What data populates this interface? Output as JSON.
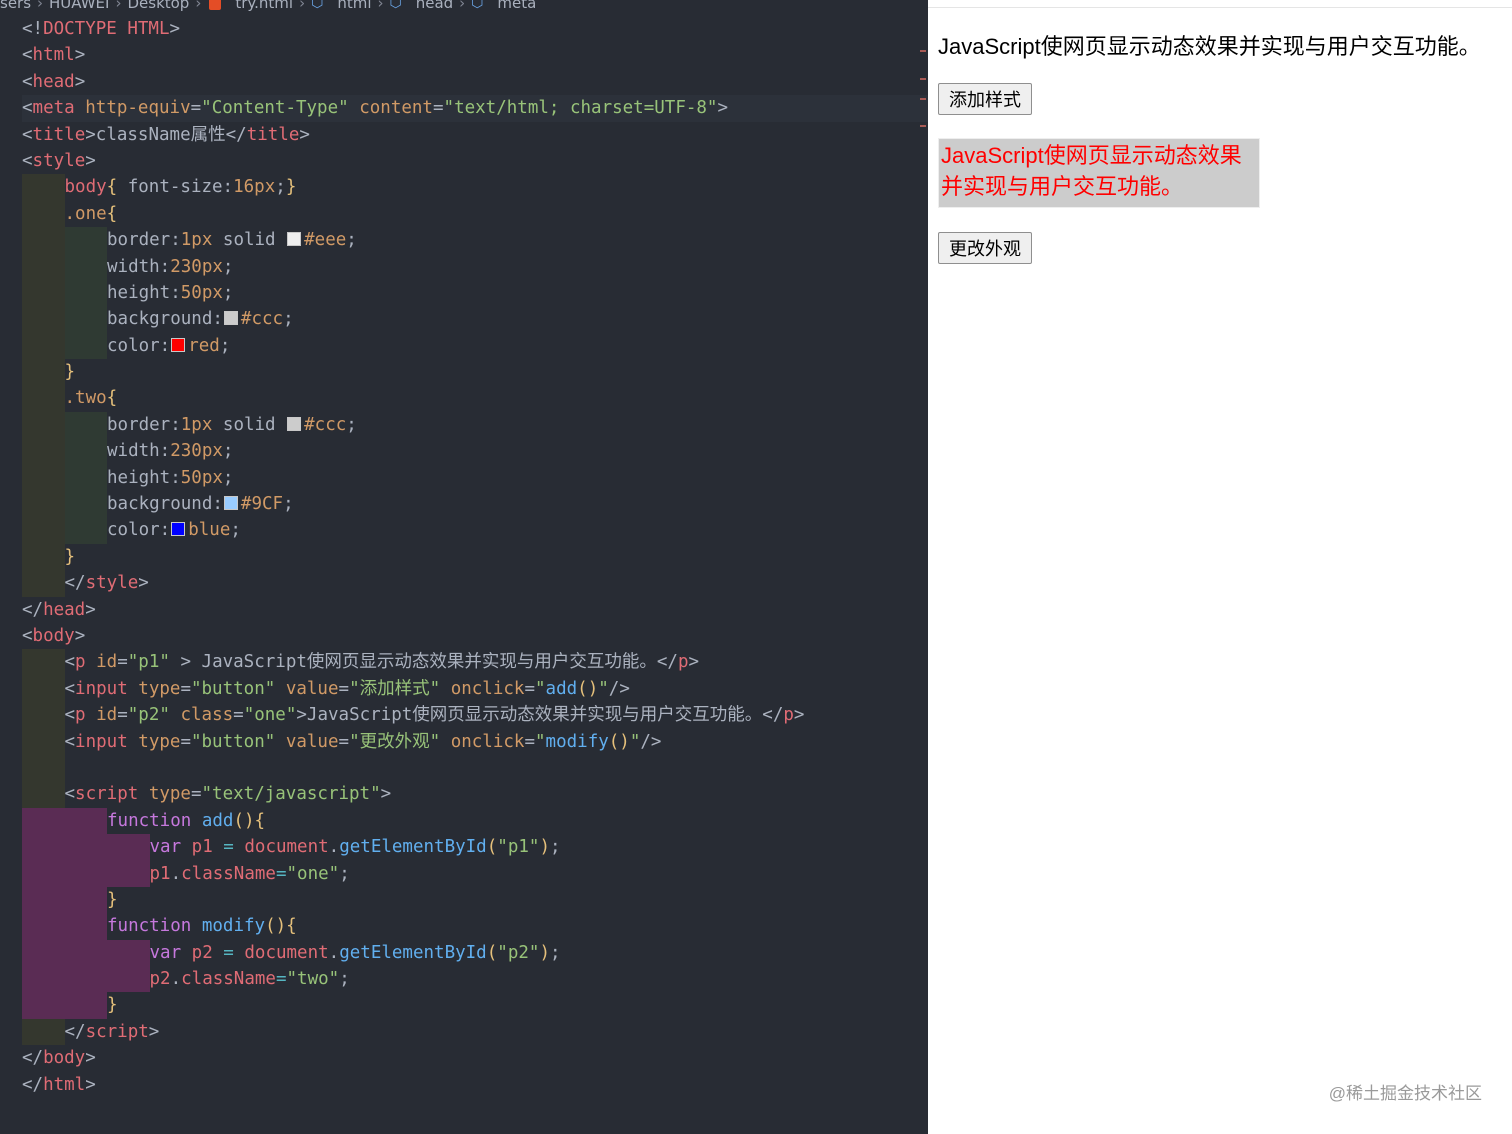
{
  "breadcrumb": {
    "items": [
      "sers",
      "HUAWEI",
      "Desktop",
      "try.html",
      "html",
      "head",
      "meta"
    ]
  },
  "editor": {
    "lines": [
      {
        "g": [],
        "tokens": [
          [
            "t-br",
            "<!"
          ],
          [
            "t-tag",
            "DOCTYPE HTML"
          ],
          [
            "t-br",
            ">"
          ]
        ]
      },
      {
        "g": [],
        "tokens": [
          [
            "t-br",
            "<"
          ],
          [
            "t-tag",
            "html"
          ],
          [
            "t-br",
            ">"
          ]
        ]
      },
      {
        "g": [],
        "tokens": [
          [
            "t-br",
            "<"
          ],
          [
            "t-tag",
            "head"
          ],
          [
            "t-br",
            ">"
          ]
        ]
      },
      {
        "g": [],
        "hl": true,
        "tokens": [
          [
            "t-br",
            "<"
          ],
          [
            "t-tag",
            "meta"
          ],
          [
            "t-plain",
            " "
          ],
          [
            "t-attr",
            "http-equiv"
          ],
          [
            "t-plain",
            "="
          ],
          [
            "t-str",
            "\"Content-Type\""
          ],
          [
            "t-plain",
            " "
          ],
          [
            "t-attr",
            "content"
          ],
          [
            "t-plain",
            "="
          ],
          [
            "t-str",
            "\"text/html; charset=UTF-8\""
          ],
          [
            "t-br",
            ">"
          ]
        ]
      },
      {
        "g": [],
        "tokens": [
          [
            "t-br",
            "<"
          ],
          [
            "t-tag",
            "title"
          ],
          [
            "t-br",
            ">"
          ],
          [
            "t-plain",
            "className属性"
          ],
          [
            "t-br",
            "</"
          ],
          [
            "t-tag",
            "title"
          ],
          [
            "t-br",
            ">"
          ]
        ]
      },
      {
        "g": [],
        "tokens": [
          [
            "t-br",
            "<"
          ],
          [
            "t-tag",
            "style"
          ],
          [
            "t-br",
            ">"
          ]
        ]
      },
      {
        "g": [
          "g1"
        ],
        "tokens": [
          [
            "t-sel",
            "body"
          ],
          [
            "t-yellow",
            "{"
          ],
          [
            "t-plain",
            " font-size:"
          ],
          [
            "t-num",
            "16px"
          ],
          [
            "t-plain",
            ";"
          ],
          [
            "t-yellow",
            "}"
          ]
        ]
      },
      {
        "g": [
          "g1"
        ],
        "tokens": [
          [
            "t-cls",
            ".one"
          ],
          [
            "t-yellow",
            "{"
          ]
        ]
      },
      {
        "g": [
          "g1",
          "g2"
        ],
        "tokens": [
          [
            "t-prop",
            "border:"
          ],
          [
            "t-num",
            "1px"
          ],
          [
            "t-plain",
            " solid "
          ],
          [
            "swatch",
            "#eeeeee"
          ],
          [
            "t-num",
            "#eee"
          ],
          [
            "t-plain",
            ";"
          ]
        ]
      },
      {
        "g": [
          "g1",
          "g2"
        ],
        "tokens": [
          [
            "t-prop",
            "width:"
          ],
          [
            "t-num",
            "230px"
          ],
          [
            "t-plain",
            ";"
          ]
        ]
      },
      {
        "g": [
          "g1",
          "g2"
        ],
        "tokens": [
          [
            "t-prop",
            "height:"
          ],
          [
            "t-num",
            "50px"
          ],
          [
            "t-plain",
            ";"
          ]
        ]
      },
      {
        "g": [
          "g1",
          "g2"
        ],
        "tokens": [
          [
            "t-prop",
            "background:"
          ],
          [
            "swatch",
            "#cccccc"
          ],
          [
            "t-num",
            "#ccc"
          ],
          [
            "t-plain",
            ";"
          ]
        ]
      },
      {
        "g": [
          "g1",
          "g2"
        ],
        "tokens": [
          [
            "t-prop",
            "color:"
          ],
          [
            "swatch",
            "#ff0000"
          ],
          [
            "t-num",
            "red"
          ],
          [
            "t-plain",
            ";"
          ]
        ]
      },
      {
        "g": [
          "g1"
        ],
        "tokens": [
          [
            "t-yellow",
            "}"
          ]
        ]
      },
      {
        "g": [
          "g1"
        ],
        "tokens": [
          [
            "t-cls",
            ".two"
          ],
          [
            "t-yellow",
            "{"
          ]
        ]
      },
      {
        "g": [
          "g1",
          "g2"
        ],
        "tokens": [
          [
            "t-prop",
            "border:"
          ],
          [
            "t-num",
            "1px"
          ],
          [
            "t-plain",
            " solid "
          ],
          [
            "swatch",
            "#cccccc"
          ],
          [
            "t-num",
            "#ccc"
          ],
          [
            "t-plain",
            ";"
          ]
        ]
      },
      {
        "g": [
          "g1",
          "g2"
        ],
        "tokens": [
          [
            "t-prop",
            "width:"
          ],
          [
            "t-num",
            "230px"
          ],
          [
            "t-plain",
            ";"
          ]
        ]
      },
      {
        "g": [
          "g1",
          "g2"
        ],
        "tokens": [
          [
            "t-prop",
            "height:"
          ],
          [
            "t-num",
            "50px"
          ],
          [
            "t-plain",
            ";"
          ]
        ]
      },
      {
        "g": [
          "g1",
          "g2"
        ],
        "tokens": [
          [
            "t-prop",
            "background:"
          ],
          [
            "swatch",
            "#99ccff"
          ],
          [
            "t-num",
            "#9CF"
          ],
          [
            "t-plain",
            ";"
          ]
        ]
      },
      {
        "g": [
          "g1",
          "g2"
        ],
        "tokens": [
          [
            "t-prop",
            "color:"
          ],
          [
            "swatch",
            "#0000ff"
          ],
          [
            "t-num",
            "blue"
          ],
          [
            "t-plain",
            ";"
          ]
        ]
      },
      {
        "g": [
          "g1"
        ],
        "tokens": [
          [
            "t-yellow",
            "}"
          ]
        ]
      },
      {
        "g": [
          "g1"
        ],
        "tokens": [
          [
            "t-br",
            "</"
          ],
          [
            "t-tag",
            "style"
          ],
          [
            "t-br",
            ">"
          ]
        ]
      },
      {
        "g": [],
        "tokens": [
          [
            "t-br",
            "</"
          ],
          [
            "t-tag",
            "head"
          ],
          [
            "t-br",
            ">"
          ]
        ]
      },
      {
        "g": [],
        "tokens": [
          [
            "t-br",
            "<"
          ],
          [
            "t-tag",
            "body"
          ],
          [
            "t-br",
            ">"
          ]
        ]
      },
      {
        "g": [
          "g1"
        ],
        "tokens": [
          [
            "t-br",
            "<"
          ],
          [
            "t-tag",
            "p"
          ],
          [
            "t-plain",
            " "
          ],
          [
            "t-attr",
            "id"
          ],
          [
            "t-plain",
            "="
          ],
          [
            "t-str",
            "\"p1\""
          ],
          [
            "t-plain",
            " > JavaScript使网页显示动态效果并实现与用户交互功能。"
          ],
          [
            "t-br",
            "</"
          ],
          [
            "t-tag",
            "p"
          ],
          [
            "t-br",
            ">"
          ]
        ]
      },
      {
        "g": [
          "g1"
        ],
        "tokens": [
          [
            "t-br",
            "<"
          ],
          [
            "t-tag",
            "input"
          ],
          [
            "t-plain",
            " "
          ],
          [
            "t-attr",
            "type"
          ],
          [
            "t-plain",
            "="
          ],
          [
            "t-str",
            "\"button\""
          ],
          [
            "t-plain",
            " "
          ],
          [
            "t-attr",
            "value"
          ],
          [
            "t-plain",
            "="
          ],
          [
            "t-str",
            "\"添加样式\""
          ],
          [
            "t-plain",
            " "
          ],
          [
            "t-attr",
            "onclick"
          ],
          [
            "t-plain",
            "="
          ],
          [
            "t-str",
            "\""
          ],
          [
            "t-fn",
            "add"
          ],
          [
            "t-yellow",
            "()"
          ],
          [
            "t-str",
            "\""
          ],
          [
            "t-br",
            "/>"
          ]
        ]
      },
      {
        "g": [
          "g1"
        ],
        "tokens": [
          [
            "t-br",
            "<"
          ],
          [
            "t-tag",
            "p"
          ],
          [
            "t-plain",
            " "
          ],
          [
            "t-attr",
            "id"
          ],
          [
            "t-plain",
            "="
          ],
          [
            "t-str",
            "\"p2\""
          ],
          [
            "t-plain",
            " "
          ],
          [
            "t-attr",
            "class"
          ],
          [
            "t-plain",
            "="
          ],
          [
            "t-str",
            "\"one\""
          ],
          [
            "t-plain",
            ">JavaScript使网页显示动态效果并实现与用户交互功能。"
          ],
          [
            "t-br",
            "</"
          ],
          [
            "t-tag",
            "p"
          ],
          [
            "t-br",
            ">"
          ]
        ]
      },
      {
        "g": [
          "g1"
        ],
        "tokens": [
          [
            "t-br",
            "<"
          ],
          [
            "t-tag",
            "input"
          ],
          [
            "t-plain",
            " "
          ],
          [
            "t-attr",
            "type"
          ],
          [
            "t-plain",
            "="
          ],
          [
            "t-str",
            "\"button\""
          ],
          [
            "t-plain",
            " "
          ],
          [
            "t-attr",
            "value"
          ],
          [
            "t-plain",
            "="
          ],
          [
            "t-str",
            "\"更改外观\""
          ],
          [
            "t-plain",
            " "
          ],
          [
            "t-attr",
            "onclick"
          ],
          [
            "t-plain",
            "="
          ],
          [
            "t-str",
            "\""
          ],
          [
            "t-fn",
            "modify"
          ],
          [
            "t-yellow",
            "()"
          ],
          [
            "t-str",
            "\""
          ],
          [
            "t-br",
            "/>"
          ]
        ]
      },
      {
        "g": [
          "g1"
        ],
        "tokens": []
      },
      {
        "g": [
          "g1"
        ],
        "tokens": [
          [
            "t-br",
            "<"
          ],
          [
            "t-tag",
            "script"
          ],
          [
            "t-plain",
            " "
          ],
          [
            "t-attr",
            "type"
          ],
          [
            "t-plain",
            "="
          ],
          [
            "t-str",
            "\"text/javascript\""
          ],
          [
            "t-br",
            ">"
          ]
        ]
      },
      {
        "g": [
          "gp",
          "gp"
        ],
        "tokens": [
          [
            "t-kw",
            "function"
          ],
          [
            "t-plain",
            " "
          ],
          [
            "t-fn",
            "add"
          ],
          [
            "t-yellow",
            "(){"
          ]
        ]
      },
      {
        "g": [
          "gp",
          "gp",
          "gp"
        ],
        "tokens": [
          [
            "t-kw",
            "var"
          ],
          [
            "t-plain",
            " "
          ],
          [
            "t-var",
            "p1"
          ],
          [
            "t-plain",
            " "
          ],
          [
            "t-op",
            "="
          ],
          [
            "t-plain",
            " "
          ],
          [
            "t-var",
            "document"
          ],
          [
            "t-plain",
            "."
          ],
          [
            "t-fn",
            "getElementById"
          ],
          [
            "t-yellow",
            "("
          ],
          [
            "t-str",
            "\"p1\""
          ],
          [
            "t-yellow",
            ")"
          ],
          [
            "t-plain",
            ";"
          ]
        ]
      },
      {
        "g": [
          "gp",
          "gp",
          "gp"
        ],
        "tokens": [
          [
            "t-var",
            "p1"
          ],
          [
            "t-plain",
            "."
          ],
          [
            "t-var",
            "className"
          ],
          [
            "t-op",
            "="
          ],
          [
            "t-str",
            "\"one\""
          ],
          [
            "t-plain",
            ";"
          ]
        ]
      },
      {
        "g": [
          "gp",
          "gp"
        ],
        "tokens": [
          [
            "t-yellow",
            "}"
          ]
        ]
      },
      {
        "g": [
          "gp",
          "gp"
        ],
        "tokens": [
          [
            "t-kw",
            "function"
          ],
          [
            "t-plain",
            " "
          ],
          [
            "t-fn",
            "modify"
          ],
          [
            "t-yellow",
            "(){"
          ]
        ]
      },
      {
        "g": [
          "gp",
          "gp",
          "gp"
        ],
        "tokens": [
          [
            "t-kw",
            "var"
          ],
          [
            "t-plain",
            " "
          ],
          [
            "t-var",
            "p2"
          ],
          [
            "t-plain",
            " "
          ],
          [
            "t-op",
            "="
          ],
          [
            "t-plain",
            " "
          ],
          [
            "t-var",
            "document"
          ],
          [
            "t-plain",
            "."
          ],
          [
            "t-fn",
            "getElementById"
          ],
          [
            "t-yellow",
            "("
          ],
          [
            "t-str",
            "\"p2\""
          ],
          [
            "t-yellow",
            ")"
          ],
          [
            "t-plain",
            ";"
          ]
        ]
      },
      {
        "g": [
          "gp",
          "gp",
          "gp"
        ],
        "tokens": [
          [
            "t-var",
            "p2"
          ],
          [
            "t-plain",
            "."
          ],
          [
            "t-var",
            "className"
          ],
          [
            "t-op",
            "="
          ],
          [
            "t-str",
            "\"two\""
          ],
          [
            "t-plain",
            ";"
          ]
        ]
      },
      {
        "g": [
          "gp",
          "gp"
        ],
        "tokens": [
          [
            "t-yellow",
            "}"
          ]
        ]
      },
      {
        "g": [
          "g1"
        ],
        "tokens": [
          [
            "t-br",
            "</"
          ],
          [
            "t-tag",
            "script"
          ],
          [
            "t-br",
            ">"
          ]
        ]
      },
      {
        "g": [],
        "tokens": [
          [
            "t-br",
            "</"
          ],
          [
            "t-tag",
            "body"
          ],
          [
            "t-br",
            ">"
          ]
        ]
      },
      {
        "g": [],
        "tokens": [
          [
            "t-br",
            "</"
          ],
          [
            "t-tag",
            "html"
          ],
          [
            "t-br",
            ">"
          ]
        ]
      }
    ]
  },
  "preview": {
    "p1_text": "JavaScript使网页显示动态效果并实现与用户交互功能。",
    "add_button": "添加样式",
    "p2_text": "JavaScript使网页显示动态效果并实现与用户交互功能。",
    "modify_button": "更改外观",
    "watermark": "@稀土掘金技术社区"
  },
  "colors": {
    "editor_bg": "#282c34",
    "p2_background": "#cccccc",
    "p2_text": "#ff0000"
  }
}
